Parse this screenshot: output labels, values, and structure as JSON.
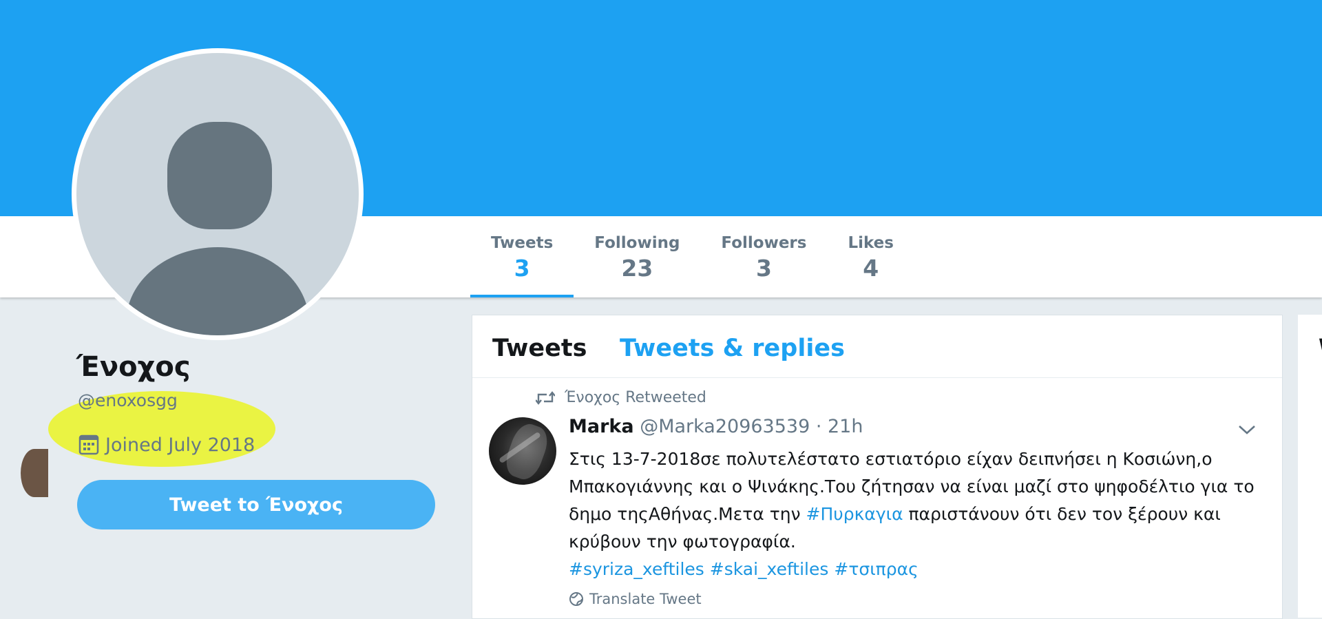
{
  "colors": {
    "accent": "#1da1f2",
    "banner": "#1da1f2",
    "text_secondary": "#657786",
    "highlight": "#ebf500"
  },
  "profile": {
    "name": "Ένοχος",
    "handle": "@enoxosgg",
    "joined": "Joined July 2018",
    "tweet_to_label": "Tweet to Ένοχος",
    "avatar_icon": "default-avatar-icon"
  },
  "stats": [
    {
      "label": "Tweets",
      "value": "3",
      "active": true
    },
    {
      "label": "Following",
      "value": "23"
    },
    {
      "label": "Followers",
      "value": "3"
    },
    {
      "label": "Likes",
      "value": "4"
    }
  ],
  "timeline": {
    "tabs": [
      {
        "label": "Tweets",
        "active": true
      },
      {
        "label": "Tweets & replies"
      }
    ],
    "tweet": {
      "retweeted_by": "Ένοχος Retweeted",
      "author": "Marka",
      "handle_time": "@Marka20963539 · 21h",
      "lines": {
        "l1": "Στις 13-7-2018σε πολυτελέστατο εστιατόριο είχαν δειπνήσει η Κοσιώνη,ο",
        "l2": "Μπακογιάννης και ο Ψινάκης.Του ζήτησαν να είναι μαζί στο ψηφοδέλτιο για το",
        "l3_pre": "δημο τηςΑθήνας.Μετα την ",
        "l3_tag": "#Πυρκαγια",
        "l3_post": " παριστάνουν ότι δεν τον ξέρουν και",
        "l4": "κρύβουν την φωτογραφία."
      },
      "hashtags": [
        "#syriza_xeftiles",
        "#skai_xeftiles",
        "#τσιπρας"
      ],
      "translate_label": "Translate Tweet"
    }
  },
  "right_sidebar": {
    "glyph": "W"
  }
}
